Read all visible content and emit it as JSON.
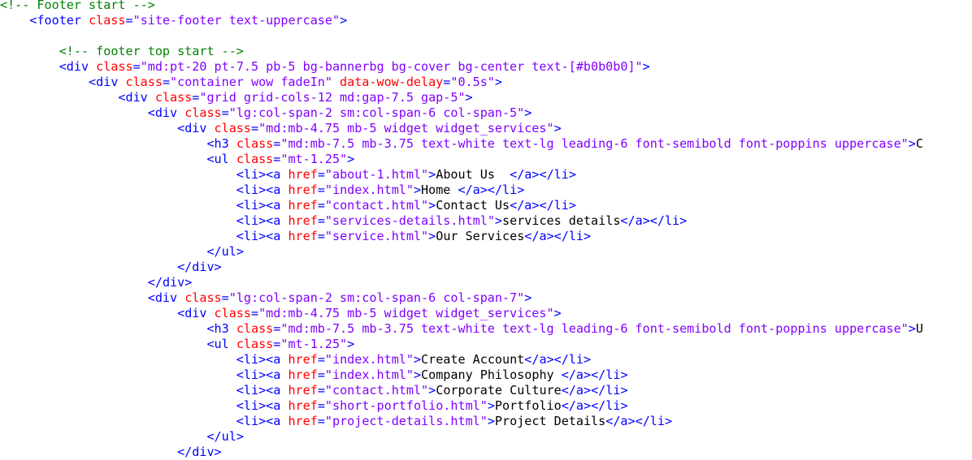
{
  "colors": {
    "comment": "#008000",
    "tag": "#0000ff",
    "attr": "#ff0000",
    "value": "#8000ff",
    "text": "#000000",
    "background": "#ffffff"
  },
  "lines": [
    {
      "indent": 0,
      "tokens": [
        {
          "k": "c",
          "t": "<!-- Footer start -->"
        }
      ]
    },
    {
      "indent": 4,
      "tokens": [
        {
          "k": "p",
          "t": "<"
        },
        {
          "k": "t",
          "t": "footer"
        },
        {
          "k": "x",
          "t": " "
        },
        {
          "k": "a",
          "t": "class"
        },
        {
          "k": "p",
          "t": "="
        },
        {
          "k": "v",
          "t": "\"site-footer text-uppercase\""
        },
        {
          "k": "p",
          "t": ">"
        }
      ]
    },
    {
      "indent": 0,
      "tokens": []
    },
    {
      "indent": 8,
      "tokens": [
        {
          "k": "c",
          "t": "<!-- footer top start -->"
        }
      ]
    },
    {
      "indent": 8,
      "tokens": [
        {
          "k": "p",
          "t": "<"
        },
        {
          "k": "t",
          "t": "div"
        },
        {
          "k": "x",
          "t": " "
        },
        {
          "k": "a",
          "t": "class"
        },
        {
          "k": "p",
          "t": "="
        },
        {
          "k": "v",
          "t": "\"md:pt-20 pt-7.5 pb-5 bg-bannerbg bg-cover bg-center text-[#b0b0b0]\""
        },
        {
          "k": "p",
          "t": ">"
        }
      ]
    },
    {
      "indent": 12,
      "tokens": [
        {
          "k": "p",
          "t": "<"
        },
        {
          "k": "t",
          "t": "div"
        },
        {
          "k": "x",
          "t": " "
        },
        {
          "k": "a",
          "t": "class"
        },
        {
          "k": "p",
          "t": "="
        },
        {
          "k": "v",
          "t": "\"container wow fadeIn\""
        },
        {
          "k": "x",
          "t": " "
        },
        {
          "k": "a",
          "t": "data-wow-delay"
        },
        {
          "k": "p",
          "t": "="
        },
        {
          "k": "v",
          "t": "\"0.5s\""
        },
        {
          "k": "p",
          "t": ">"
        }
      ]
    },
    {
      "indent": 16,
      "tokens": [
        {
          "k": "p",
          "t": "<"
        },
        {
          "k": "t",
          "t": "div"
        },
        {
          "k": "x",
          "t": " "
        },
        {
          "k": "a",
          "t": "class"
        },
        {
          "k": "p",
          "t": "="
        },
        {
          "k": "v",
          "t": "\"grid grid-cols-12 md:gap-7.5 gap-5\""
        },
        {
          "k": "p",
          "t": ">"
        }
      ]
    },
    {
      "indent": 20,
      "tokens": [
        {
          "k": "p",
          "t": "<"
        },
        {
          "k": "t",
          "t": "div"
        },
        {
          "k": "x",
          "t": " "
        },
        {
          "k": "a",
          "t": "class"
        },
        {
          "k": "p",
          "t": "="
        },
        {
          "k": "v",
          "t": "\"lg:col-span-2 sm:col-span-6 col-span-5\""
        },
        {
          "k": "p",
          "t": ">"
        }
      ]
    },
    {
      "indent": 24,
      "tokens": [
        {
          "k": "p",
          "t": "<"
        },
        {
          "k": "t",
          "t": "div"
        },
        {
          "k": "x",
          "t": " "
        },
        {
          "k": "a",
          "t": "class"
        },
        {
          "k": "p",
          "t": "="
        },
        {
          "k": "v",
          "t": "\"md:mb-4.75 mb-5 widget widget_services\""
        },
        {
          "k": "p",
          "t": ">"
        }
      ]
    },
    {
      "indent": 28,
      "tokens": [
        {
          "k": "p",
          "t": "<"
        },
        {
          "k": "t",
          "t": "h3"
        },
        {
          "k": "x",
          "t": " "
        },
        {
          "k": "a",
          "t": "class"
        },
        {
          "k": "p",
          "t": "="
        },
        {
          "k": "v",
          "t": "\"md:mb-7.5 mb-3.75 text-white text-lg leading-6 font-semibold font-poppins uppercase\""
        },
        {
          "k": "p",
          "t": ">"
        },
        {
          "k": "x",
          "t": "C"
        }
      ]
    },
    {
      "indent": 28,
      "tokens": [
        {
          "k": "p",
          "t": "<"
        },
        {
          "k": "t",
          "t": "ul"
        },
        {
          "k": "x",
          "t": " "
        },
        {
          "k": "a",
          "t": "class"
        },
        {
          "k": "p",
          "t": "="
        },
        {
          "k": "v",
          "t": "\"mt-1.25\""
        },
        {
          "k": "p",
          "t": ">"
        }
      ]
    },
    {
      "indent": 32,
      "tokens": [
        {
          "k": "p",
          "t": "<"
        },
        {
          "k": "t",
          "t": "li"
        },
        {
          "k": "p",
          "t": "><"
        },
        {
          "k": "t",
          "t": "a"
        },
        {
          "k": "x",
          "t": " "
        },
        {
          "k": "a",
          "t": "href"
        },
        {
          "k": "p",
          "t": "="
        },
        {
          "k": "v",
          "t": "\"about-1.html\""
        },
        {
          "k": "p",
          "t": ">"
        },
        {
          "k": "x",
          "t": "About Us  "
        },
        {
          "k": "p",
          "t": "</"
        },
        {
          "k": "t",
          "t": "a"
        },
        {
          "k": "p",
          "t": "></"
        },
        {
          "k": "t",
          "t": "li"
        },
        {
          "k": "p",
          "t": ">"
        }
      ]
    },
    {
      "indent": 32,
      "tokens": [
        {
          "k": "p",
          "t": "<"
        },
        {
          "k": "t",
          "t": "li"
        },
        {
          "k": "p",
          "t": "><"
        },
        {
          "k": "t",
          "t": "a"
        },
        {
          "k": "x",
          "t": " "
        },
        {
          "k": "a",
          "t": "href"
        },
        {
          "k": "p",
          "t": "="
        },
        {
          "k": "v",
          "t": "\"index.html\""
        },
        {
          "k": "p",
          "t": ">"
        },
        {
          "k": "x",
          "t": "Home "
        },
        {
          "k": "p",
          "t": "</"
        },
        {
          "k": "t",
          "t": "a"
        },
        {
          "k": "p",
          "t": "></"
        },
        {
          "k": "t",
          "t": "li"
        },
        {
          "k": "p",
          "t": ">"
        }
      ]
    },
    {
      "indent": 32,
      "tokens": [
        {
          "k": "p",
          "t": "<"
        },
        {
          "k": "t",
          "t": "li"
        },
        {
          "k": "p",
          "t": "><"
        },
        {
          "k": "t",
          "t": "a"
        },
        {
          "k": "x",
          "t": " "
        },
        {
          "k": "a",
          "t": "href"
        },
        {
          "k": "p",
          "t": "="
        },
        {
          "k": "v",
          "t": "\"contact.html\""
        },
        {
          "k": "p",
          "t": ">"
        },
        {
          "k": "x",
          "t": "Contact Us"
        },
        {
          "k": "p",
          "t": "</"
        },
        {
          "k": "t",
          "t": "a"
        },
        {
          "k": "p",
          "t": "></"
        },
        {
          "k": "t",
          "t": "li"
        },
        {
          "k": "p",
          "t": ">"
        }
      ]
    },
    {
      "indent": 32,
      "tokens": [
        {
          "k": "p",
          "t": "<"
        },
        {
          "k": "t",
          "t": "li"
        },
        {
          "k": "p",
          "t": "><"
        },
        {
          "k": "t",
          "t": "a"
        },
        {
          "k": "x",
          "t": " "
        },
        {
          "k": "a",
          "t": "href"
        },
        {
          "k": "p",
          "t": "="
        },
        {
          "k": "v",
          "t": "\"services-details.html\""
        },
        {
          "k": "p",
          "t": ">"
        },
        {
          "k": "x",
          "t": "services details"
        },
        {
          "k": "p",
          "t": "</"
        },
        {
          "k": "t",
          "t": "a"
        },
        {
          "k": "p",
          "t": "></"
        },
        {
          "k": "t",
          "t": "li"
        },
        {
          "k": "p",
          "t": ">"
        }
      ]
    },
    {
      "indent": 32,
      "tokens": [
        {
          "k": "p",
          "t": "<"
        },
        {
          "k": "t",
          "t": "li"
        },
        {
          "k": "p",
          "t": "><"
        },
        {
          "k": "t",
          "t": "a"
        },
        {
          "k": "x",
          "t": " "
        },
        {
          "k": "a",
          "t": "href"
        },
        {
          "k": "p",
          "t": "="
        },
        {
          "k": "v",
          "t": "\"service.html\""
        },
        {
          "k": "p",
          "t": ">"
        },
        {
          "k": "x",
          "t": "Our Services"
        },
        {
          "k": "p",
          "t": "</"
        },
        {
          "k": "t",
          "t": "a"
        },
        {
          "k": "p",
          "t": "></"
        },
        {
          "k": "t",
          "t": "li"
        },
        {
          "k": "p",
          "t": ">"
        }
      ]
    },
    {
      "indent": 28,
      "tokens": [
        {
          "k": "p",
          "t": "</"
        },
        {
          "k": "t",
          "t": "ul"
        },
        {
          "k": "p",
          "t": ">"
        }
      ]
    },
    {
      "indent": 24,
      "tokens": [
        {
          "k": "p",
          "t": "</"
        },
        {
          "k": "t",
          "t": "div"
        },
        {
          "k": "p",
          "t": ">"
        }
      ]
    },
    {
      "indent": 20,
      "tokens": [
        {
          "k": "p",
          "t": "</"
        },
        {
          "k": "t",
          "t": "div"
        },
        {
          "k": "p",
          "t": ">"
        }
      ]
    },
    {
      "indent": 20,
      "tokens": [
        {
          "k": "p",
          "t": "<"
        },
        {
          "k": "t",
          "t": "div"
        },
        {
          "k": "x",
          "t": " "
        },
        {
          "k": "a",
          "t": "class"
        },
        {
          "k": "p",
          "t": "="
        },
        {
          "k": "v",
          "t": "\"lg:col-span-2 sm:col-span-6 col-span-7\""
        },
        {
          "k": "p",
          "t": ">"
        }
      ]
    },
    {
      "indent": 24,
      "tokens": [
        {
          "k": "p",
          "t": "<"
        },
        {
          "k": "t",
          "t": "div"
        },
        {
          "k": "x",
          "t": " "
        },
        {
          "k": "a",
          "t": "class"
        },
        {
          "k": "p",
          "t": "="
        },
        {
          "k": "v",
          "t": "\"md:mb-4.75 mb-5 widget widget_services\""
        },
        {
          "k": "p",
          "t": ">"
        }
      ]
    },
    {
      "indent": 28,
      "tokens": [
        {
          "k": "p",
          "t": "<"
        },
        {
          "k": "t",
          "t": "h3"
        },
        {
          "k": "x",
          "t": " "
        },
        {
          "k": "a",
          "t": "class"
        },
        {
          "k": "p",
          "t": "="
        },
        {
          "k": "v",
          "t": "\"md:mb-7.5 mb-3.75 text-white text-lg leading-6 font-semibold font-poppins uppercase\""
        },
        {
          "k": "p",
          "t": ">"
        },
        {
          "k": "x",
          "t": "U"
        }
      ]
    },
    {
      "indent": 28,
      "tokens": [
        {
          "k": "p",
          "t": "<"
        },
        {
          "k": "t",
          "t": "ul"
        },
        {
          "k": "x",
          "t": " "
        },
        {
          "k": "a",
          "t": "class"
        },
        {
          "k": "p",
          "t": "="
        },
        {
          "k": "v",
          "t": "\"mt-1.25\""
        },
        {
          "k": "p",
          "t": ">"
        }
      ]
    },
    {
      "indent": 32,
      "tokens": [
        {
          "k": "p",
          "t": "<"
        },
        {
          "k": "t",
          "t": "li"
        },
        {
          "k": "p",
          "t": "><"
        },
        {
          "k": "t",
          "t": "a"
        },
        {
          "k": "x",
          "t": " "
        },
        {
          "k": "a",
          "t": "href"
        },
        {
          "k": "p",
          "t": "="
        },
        {
          "k": "v",
          "t": "\"index.html\""
        },
        {
          "k": "p",
          "t": ">"
        },
        {
          "k": "x",
          "t": "Create Account"
        },
        {
          "k": "p",
          "t": "</"
        },
        {
          "k": "t",
          "t": "a"
        },
        {
          "k": "p",
          "t": "></"
        },
        {
          "k": "t",
          "t": "li"
        },
        {
          "k": "p",
          "t": ">"
        }
      ]
    },
    {
      "indent": 32,
      "tokens": [
        {
          "k": "p",
          "t": "<"
        },
        {
          "k": "t",
          "t": "li"
        },
        {
          "k": "p",
          "t": "><"
        },
        {
          "k": "t",
          "t": "a"
        },
        {
          "k": "x",
          "t": " "
        },
        {
          "k": "a",
          "t": "href"
        },
        {
          "k": "p",
          "t": "="
        },
        {
          "k": "v",
          "t": "\"index.html\""
        },
        {
          "k": "p",
          "t": ">"
        },
        {
          "k": "x",
          "t": "Company Philosophy "
        },
        {
          "k": "p",
          "t": "</"
        },
        {
          "k": "t",
          "t": "a"
        },
        {
          "k": "p",
          "t": "></"
        },
        {
          "k": "t",
          "t": "li"
        },
        {
          "k": "p",
          "t": ">"
        }
      ]
    },
    {
      "indent": 32,
      "tokens": [
        {
          "k": "p",
          "t": "<"
        },
        {
          "k": "t",
          "t": "li"
        },
        {
          "k": "p",
          "t": "><"
        },
        {
          "k": "t",
          "t": "a"
        },
        {
          "k": "x",
          "t": " "
        },
        {
          "k": "a",
          "t": "href"
        },
        {
          "k": "p",
          "t": "="
        },
        {
          "k": "v",
          "t": "\"contact.html\""
        },
        {
          "k": "p",
          "t": ">"
        },
        {
          "k": "x",
          "t": "Corporate Culture"
        },
        {
          "k": "p",
          "t": "</"
        },
        {
          "k": "t",
          "t": "a"
        },
        {
          "k": "p",
          "t": "></"
        },
        {
          "k": "t",
          "t": "li"
        },
        {
          "k": "p",
          "t": ">"
        }
      ]
    },
    {
      "indent": 32,
      "tokens": [
        {
          "k": "p",
          "t": "<"
        },
        {
          "k": "t",
          "t": "li"
        },
        {
          "k": "p",
          "t": "><"
        },
        {
          "k": "t",
          "t": "a"
        },
        {
          "k": "x",
          "t": " "
        },
        {
          "k": "a",
          "t": "href"
        },
        {
          "k": "p",
          "t": "="
        },
        {
          "k": "v",
          "t": "\"short-portfolio.html\""
        },
        {
          "k": "p",
          "t": ">"
        },
        {
          "k": "x",
          "t": "Portfolio"
        },
        {
          "k": "p",
          "t": "</"
        },
        {
          "k": "t",
          "t": "a"
        },
        {
          "k": "p",
          "t": "></"
        },
        {
          "k": "t",
          "t": "li"
        },
        {
          "k": "p",
          "t": ">"
        }
      ]
    },
    {
      "indent": 32,
      "tokens": [
        {
          "k": "p",
          "t": "<"
        },
        {
          "k": "t",
          "t": "li"
        },
        {
          "k": "p",
          "t": "><"
        },
        {
          "k": "t",
          "t": "a"
        },
        {
          "k": "x",
          "t": " "
        },
        {
          "k": "a",
          "t": "href"
        },
        {
          "k": "p",
          "t": "="
        },
        {
          "k": "v",
          "t": "\"project-details.html\""
        },
        {
          "k": "p",
          "t": ">"
        },
        {
          "k": "x",
          "t": "Project Details"
        },
        {
          "k": "p",
          "t": "</"
        },
        {
          "k": "t",
          "t": "a"
        },
        {
          "k": "p",
          "t": "></"
        },
        {
          "k": "t",
          "t": "li"
        },
        {
          "k": "p",
          "t": ">"
        }
      ]
    },
    {
      "indent": 28,
      "tokens": [
        {
          "k": "p",
          "t": "</"
        },
        {
          "k": "t",
          "t": "ul"
        },
        {
          "k": "p",
          "t": ">"
        }
      ]
    },
    {
      "indent": 24,
      "tokens": [
        {
          "k": "p",
          "t": "</"
        },
        {
          "k": "t",
          "t": "div"
        },
        {
          "k": "p",
          "t": ">"
        }
      ]
    }
  ]
}
